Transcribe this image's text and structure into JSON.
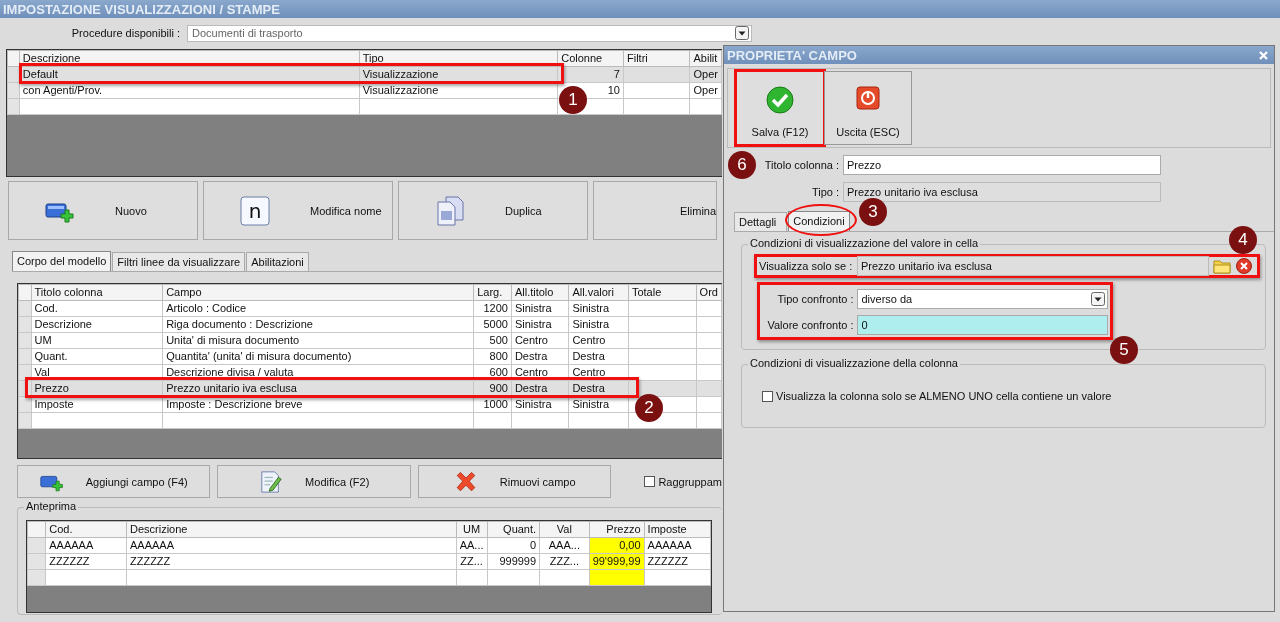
{
  "window": {
    "title": "IMPOSTAZIONE VISUALIZZAZIONI / STAMPE"
  },
  "procedure": {
    "label": "Procedure disponibili :",
    "value": "Documenti di trasporto"
  },
  "models_table": {
    "columns": [
      "Descrizione",
      "Tipo",
      "Colonne",
      "Filtri",
      "Abilit"
    ],
    "rows": [
      {
        "cells": [
          "Default",
          "Visualizzazione",
          "7",
          null,
          "Oper"
        ],
        "selected": true,
        "highlighted": true
      },
      {
        "cells": [
          "con Agenti/Prov.",
          "Visualizzazione",
          "10",
          null,
          "Oper"
        ],
        "selected": false,
        "highlighted": false
      }
    ]
  },
  "model_buttons": [
    {
      "label": "Nuovo",
      "kind": "add"
    },
    {
      "label": "Modifica nome",
      "kind": "rename",
      "glyph": "n"
    },
    {
      "label": "Duplica",
      "kind": "copy"
    },
    {
      "label": "Elimina",
      "kind": "delete"
    }
  ],
  "tabs": [
    {
      "label": "Corpo del modello",
      "selected": true
    },
    {
      "label": "Filtri linee da visualizzare",
      "selected": false
    },
    {
      "label": "Abilitazioni",
      "selected": false
    }
  ],
  "fields_table": {
    "columns": [
      "Titolo colonna",
      "Campo",
      "Larg.",
      "All.titolo",
      "All.valori",
      "Totale",
      "Ord"
    ],
    "rows": [
      {
        "cells": [
          "Cod.",
          "Articolo : Codice",
          "1200",
          "Sinistra",
          "Sinistra",
          null,
          null
        ],
        "selected": false,
        "highlighted": false
      },
      {
        "cells": [
          "Descrizione",
          "Riga documento : Descrizione",
          "5000",
          "Sinistra",
          "Sinistra",
          null,
          null
        ],
        "selected": false,
        "highlighted": false
      },
      {
        "cells": [
          "UM",
          "Unita' di misura documento",
          "500",
          "Centro",
          "Centro",
          null,
          null
        ],
        "selected": false,
        "highlighted": false
      },
      {
        "cells": [
          "Quant.",
          "Quantita' (unita' di misura documento)",
          "800",
          "Destra",
          "Destra",
          null,
          null
        ],
        "selected": false,
        "highlighted": false
      },
      {
        "cells": [
          "Val",
          "Descrizione divisa / valuta",
          "600",
          "Centro",
          "Centro",
          null,
          null
        ],
        "selected": false,
        "highlighted": false
      },
      {
        "cells": [
          "Prezzo",
          "Prezzo unitario iva esclusa",
          "900",
          "Destra",
          "Destra",
          null,
          null
        ],
        "selected": true,
        "highlighted": true
      },
      {
        "cells": [
          "Imposte",
          "Imposte : Descrizione breve",
          "1000",
          "Sinistra",
          "Sinistra",
          null,
          null
        ],
        "selected": false,
        "highlighted": false
      }
    ]
  },
  "field_buttons": [
    {
      "label": "Aggiungi campo (F4)",
      "kind": "add"
    },
    {
      "label": "Modifica (F2)",
      "kind": "edit"
    },
    {
      "label": "Rimuovi campo",
      "kind": "delete"
    }
  ],
  "group_checkbox": {
    "label": "Raggruppam",
    "checked": false
  },
  "preview": {
    "title": "Anteprima",
    "columns": [
      {
        "label": "Cod.",
        "highlighted": false
      },
      {
        "label": "Descrizione",
        "highlighted": false
      },
      {
        "label": "UM",
        "highlighted": false
      },
      {
        "label": "Quant.",
        "highlighted": false
      },
      {
        "label": "Val",
        "highlighted": false
      },
      {
        "label": "Prezzo",
        "highlighted": true
      },
      {
        "label": "Imposte",
        "highlighted": false
      }
    ],
    "rows": [
      [
        "AAAAAA",
        "AAAAAA",
        "AA...",
        "0",
        "AAA...",
        "0,00",
        "AAAAAA"
      ],
      [
        "ZZZZZZ",
        "ZZZZZZ",
        "ZZ...",
        "999999",
        "ZZZ...",
        "99'999,99",
        "ZZZZZZ"
      ]
    ]
  },
  "dialog": {
    "title": "PROPRIETA' CAMPO",
    "buttons": [
      {
        "label": "Salva (F12)",
        "kind": "save",
        "highlighted": true
      },
      {
        "label": "Uscita (ESC)",
        "kind": "exit",
        "highlighted": false
      }
    ],
    "column_title": {
      "label": "Titolo colonna :",
      "value": "Prezzo"
    },
    "type": {
      "label": "Tipo :",
      "value": "Prezzo unitario iva esclusa"
    },
    "tabs": [
      {
        "label": "Dettagli",
        "selected": false,
        "highlighted": false
      },
      {
        "label": "Condizioni",
        "selected": true,
        "highlighted": true
      }
    ],
    "cell_conditions": {
      "title": "Condizioni di visualizzazione del valore in cella",
      "show_if": {
        "label": "Visualizza solo se :",
        "value": "Prezzo unitario iva esclusa",
        "highlighted": true
      },
      "comparison": {
        "highlighted": true,
        "type": {
          "label": "Tipo confronto :",
          "value": "diverso da"
        },
        "value": {
          "label": "Valore confronto :",
          "value": "0"
        }
      }
    },
    "column_conditions": {
      "title": "Condizioni di visualizzazione della colonna",
      "checkbox": {
        "label": "Visualizza la colonna solo se ALMENO UNO cella contiene un valore",
        "checked": false
      }
    }
  },
  "markers": [
    "1",
    "2",
    "3",
    "4",
    "5",
    "6"
  ]
}
